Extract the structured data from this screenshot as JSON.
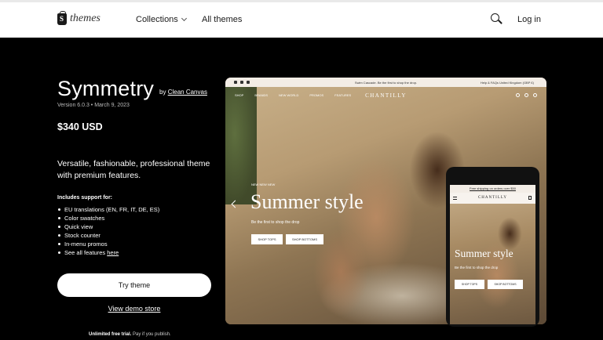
{
  "header": {
    "logo_text": "themes",
    "nav_collections": "Collections",
    "nav_all_themes": "All themes",
    "login": "Log in"
  },
  "theme": {
    "name": "Symmetry",
    "by_prefix": "by",
    "author": "Clean Canvas",
    "version": "Version 6.0.3 • March 9, 2023",
    "price": "$340 USD",
    "description": "Versatile, fashionable, professional theme with premium features.",
    "support_title": "Includes support for:",
    "features": [
      "EU translations (EN, FR, IT, DE, ES)",
      "Color swatches",
      "Quick view",
      "Stock counter",
      "In-menu promos"
    ],
    "see_all_prefix": "See all features",
    "see_all_link": "here",
    "try_button": "Try theme",
    "demo_link": "View demo store",
    "trial_bold": "Unlimited free trial.",
    "trial_text": "Pay if you publish."
  },
  "preview_desktop": {
    "promo_message": "Swim Cascade. Be the first to shop the drop.",
    "promo_right": "Help & FAQs   United Kingdom (GBP £)",
    "nav": [
      "SHOP",
      "BRANDS",
      "NEW WORLD",
      "PROMOS",
      "FEATURES"
    ],
    "logo": "CHANTILLY",
    "eyebrow": "NEW NEW NEW",
    "hero_title": "Summer style",
    "hero_subtitle": "Be the first to shop the drop",
    "button_tops": "SHOP TOPS",
    "button_bottoms": "SHOP BOTTOMS"
  },
  "preview_mobile": {
    "promo": "Free shipping on orders over $50",
    "logo": "CHANTILLY",
    "hero_title": "Summer style",
    "hero_subtitle": "Be the first to shop the drop",
    "button_tops": "SHOP TOPS",
    "button_bottoms": "SHOP BOTTOMS"
  },
  "colors": {
    "background": "#000000",
    "header_bg": "#ffffff",
    "button_bg": "#ffffff"
  }
}
